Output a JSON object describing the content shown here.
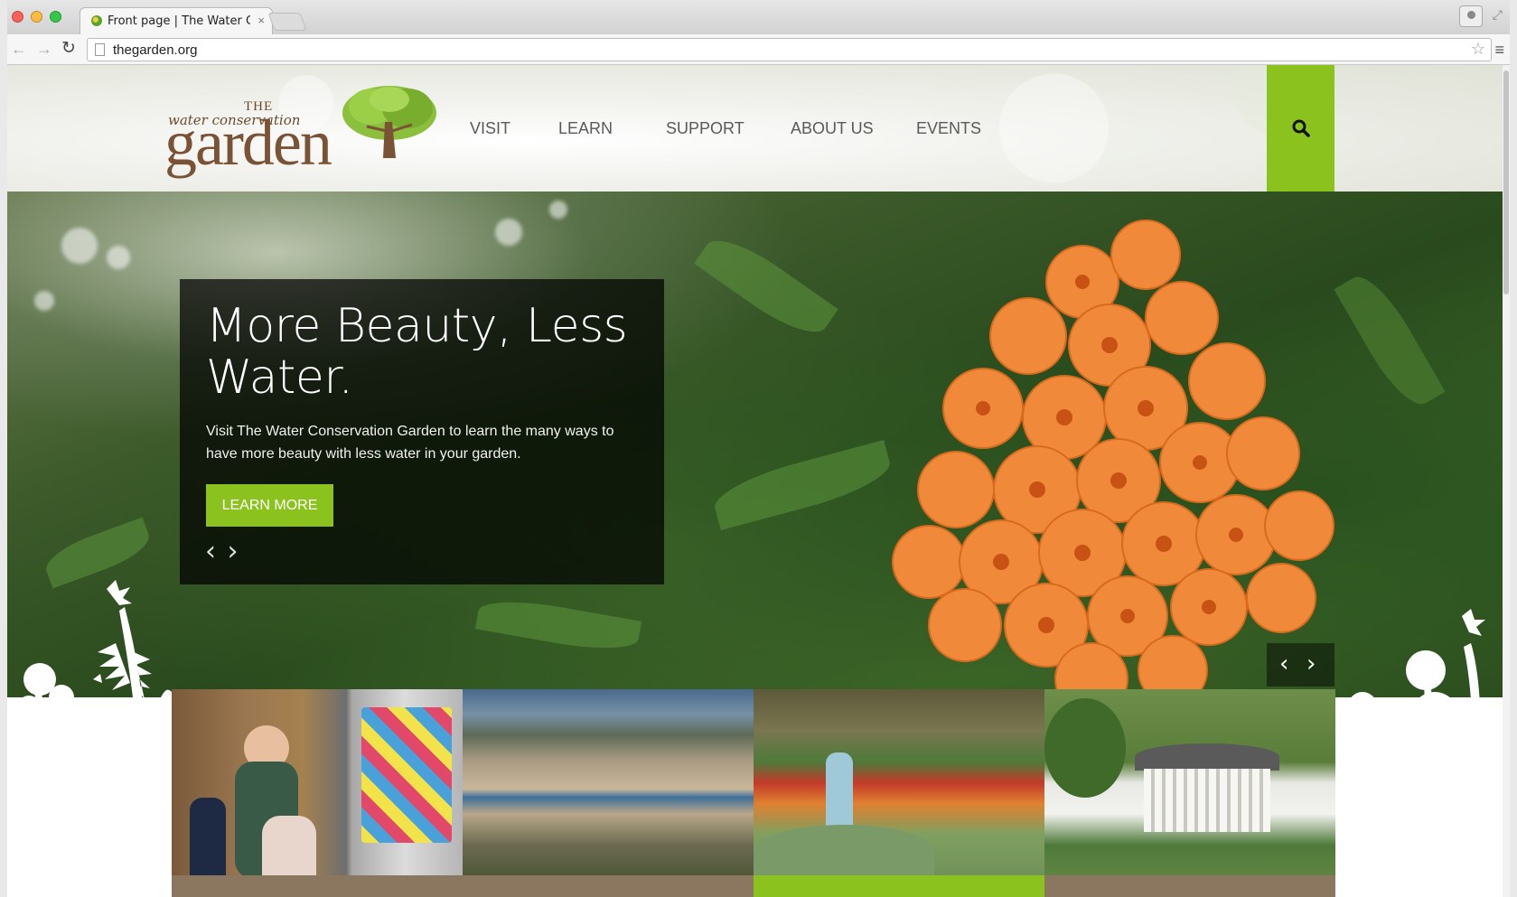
{
  "browser": {
    "tab_title": "Front page | The Water Co",
    "tab_close": "×",
    "url": "thegarden.org",
    "nav_back": "←",
    "nav_forward": "→",
    "reload": "↻",
    "star": "☆",
    "menu": "≡",
    "fullscreen": "⤢"
  },
  "site": {
    "logo": {
      "the": "THE",
      "script": "water conservation",
      "garden": "garden"
    },
    "nav": [
      "VISIT",
      "LEARN",
      "SUPPORT",
      "ABOUT US",
      "EVENTS"
    ],
    "search_icon": "🔍"
  },
  "hero": {
    "title": "More Beauty, Less Water.",
    "text": "Visit The Water Conservation Garden to learn the many ways to have more beauty with less water in your garden.",
    "cta": "LEARN MORE",
    "prev": "‹",
    "next": "›"
  },
  "colors": {
    "accent_green": "#8cc21e",
    "card_bg": "rgba(0,0,0,0.72)",
    "brown_bar": "#8b7760"
  }
}
